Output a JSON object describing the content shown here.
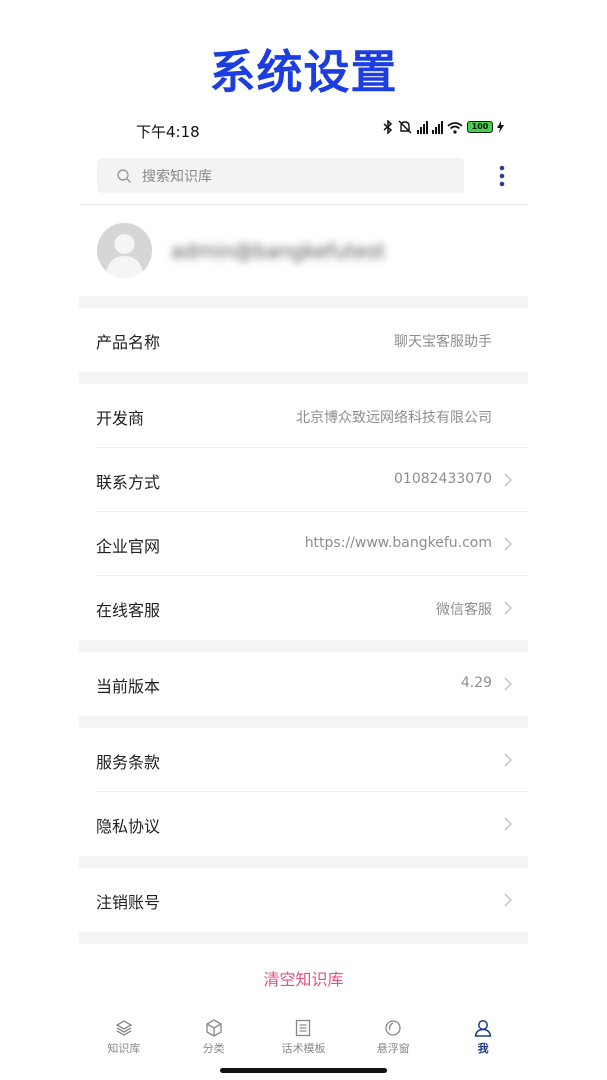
{
  "page_title": "系统设置",
  "status_bar": {
    "time": "下午4:18",
    "battery": "100",
    "icons": [
      "bluetooth-icon",
      "mute-icon",
      "signal-icon",
      "signal-icon",
      "wifi-icon",
      "battery-icon",
      "charging-icon"
    ]
  },
  "search": {
    "placeholder": "搜索知识库"
  },
  "profile": {
    "username": "admin@bangkefutest"
  },
  "rows": [
    {
      "label": "产品名称",
      "value": "聊天宝客服助手"
    },
    {
      "label": "开发商",
      "value": "北京博众致远网络科技有限公司"
    },
    {
      "label": "联系方式",
      "value": "01082433070"
    },
    {
      "label": "企业官网",
      "value": "https://www.bangkefu.com"
    },
    {
      "label": "在线客服",
      "value": "微信客服"
    },
    {
      "label": "当前版本",
      "value": "4.29"
    },
    {
      "label": "服务条款",
      "value": ""
    },
    {
      "label": "隐私协议",
      "value": ""
    },
    {
      "label": "注销账号",
      "value": ""
    }
  ],
  "clear_button": "清空知识库",
  "tabs": [
    {
      "label": "知识库",
      "icon": "layers-icon",
      "active": false
    },
    {
      "label": "分类",
      "icon": "cube-icon",
      "active": false
    },
    {
      "label": "话术模板",
      "icon": "document-icon",
      "active": false
    },
    {
      "label": "悬浮窗",
      "icon": "float-window-icon",
      "active": false
    },
    {
      "label": "我",
      "icon": "user-icon",
      "active": true
    }
  ],
  "colors": {
    "title": "#1c3ee0",
    "accent": "#1e3a8a",
    "danger": "#e0517f",
    "more": "#2c3e8f"
  }
}
